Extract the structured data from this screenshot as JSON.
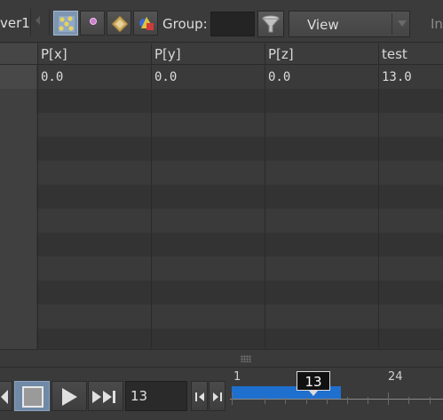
{
  "toolbar": {
    "node_name": "ver1",
    "group_label": "Group:",
    "group_value": "",
    "view_label": "View",
    "cut_label": "In",
    "icons": [
      "points-icon",
      "vertex-icon",
      "primitive-icon",
      "detail-icon",
      "filter-icon"
    ]
  },
  "sheet": {
    "columns": [
      "P[x]",
      "P[y]",
      "P[z]",
      "test"
    ],
    "rows": [
      [
        "0.0",
        "0.0",
        "0.0",
        "13.0"
      ]
    ]
  },
  "playbar": {
    "current_frame": "13",
    "timeline_start_label": "1",
    "timeline_label_2": "24",
    "cursor_frame": "13",
    "range_color": "#1f6fcf"
  }
}
